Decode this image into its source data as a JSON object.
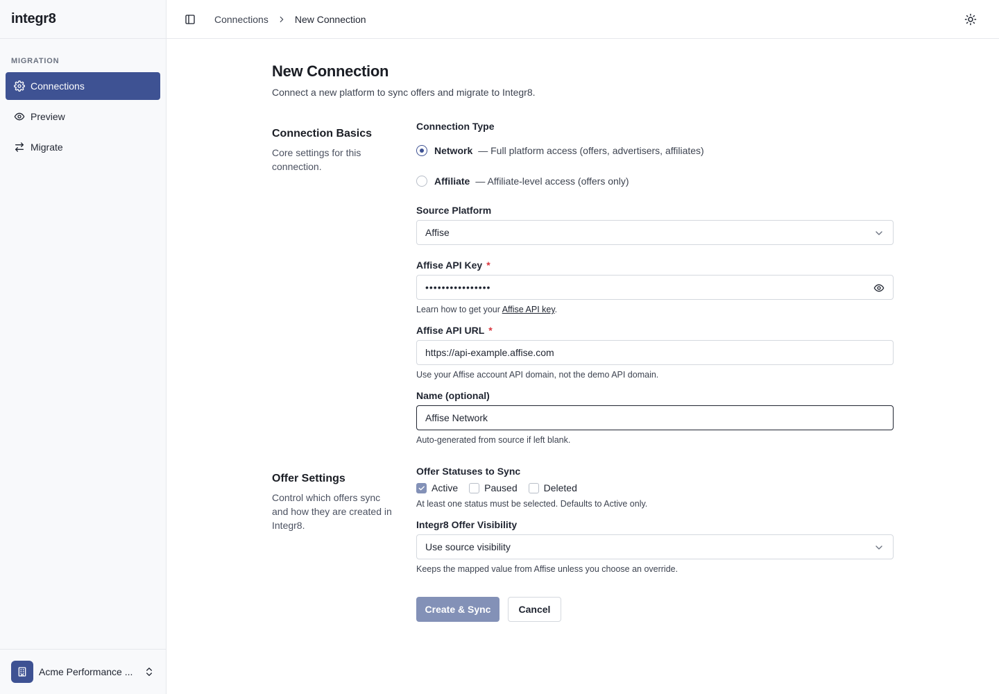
{
  "app": {
    "logo": "integr8"
  },
  "sidebar": {
    "section_label": "MIGRATION",
    "items": [
      {
        "label": "Connections",
        "icon": "gear-icon",
        "active": true
      },
      {
        "label": "Preview",
        "icon": "eye-icon",
        "active": false
      },
      {
        "label": "Migrate",
        "icon": "arrows-swap-icon",
        "active": false
      }
    ],
    "org": {
      "name": "Acme Performance ...",
      "icon": "building-icon"
    }
  },
  "header": {
    "breadcrumb": [
      "Connections",
      "New Connection"
    ]
  },
  "page": {
    "title": "New Connection",
    "description": "Connect a new platform to sync offers and migrate to Integr8."
  },
  "basics": {
    "title": "Connection Basics",
    "description": "Core settings for this connection.",
    "connection_type": {
      "label": "Connection Type",
      "options": [
        {
          "label": "Network",
          "description": "— Full platform access (offers, advertisers, affiliates)",
          "checked": true
        },
        {
          "label": "Affiliate",
          "description": "— Affiliate-level access (offers only)",
          "checked": false
        }
      ]
    },
    "source_platform": {
      "label": "Source Platform",
      "value": "Affise"
    },
    "api_key": {
      "label": "Affise API Key",
      "required": "*",
      "value": "••••••••••••••••",
      "help_prefix": "Learn how to get your ",
      "help_link": "Affise API key",
      "help_suffix": "."
    },
    "api_url": {
      "label": "Affise API URL",
      "required": "*",
      "value": "https://api-example.affise.com",
      "help": "Use your Affise account API domain, not the demo API domain."
    },
    "name": {
      "label": "Name (optional)",
      "value": "Affise Network",
      "help": "Auto-generated from source if left blank."
    }
  },
  "offers": {
    "title": "Offer Settings",
    "description": "Control which offers sync and how they are created in Integr8.",
    "statuses": {
      "label": "Offer Statuses to Sync",
      "options": [
        {
          "label": "Active",
          "checked": true
        },
        {
          "label": "Paused",
          "checked": false
        },
        {
          "label": "Deleted",
          "checked": false
        }
      ],
      "help": "At least one status must be selected. Defaults to Active only."
    },
    "visibility": {
      "label": "Integr8 Offer Visibility",
      "value": "Use source visibility",
      "help": "Keeps the mapped value from Affise unless you choose an override."
    }
  },
  "actions": {
    "primary": "Create & Sync",
    "secondary": "Cancel"
  },
  "colors": {
    "accent": "#3e5293",
    "primary_disabled": "#8391b7",
    "required": "#d9363e"
  }
}
